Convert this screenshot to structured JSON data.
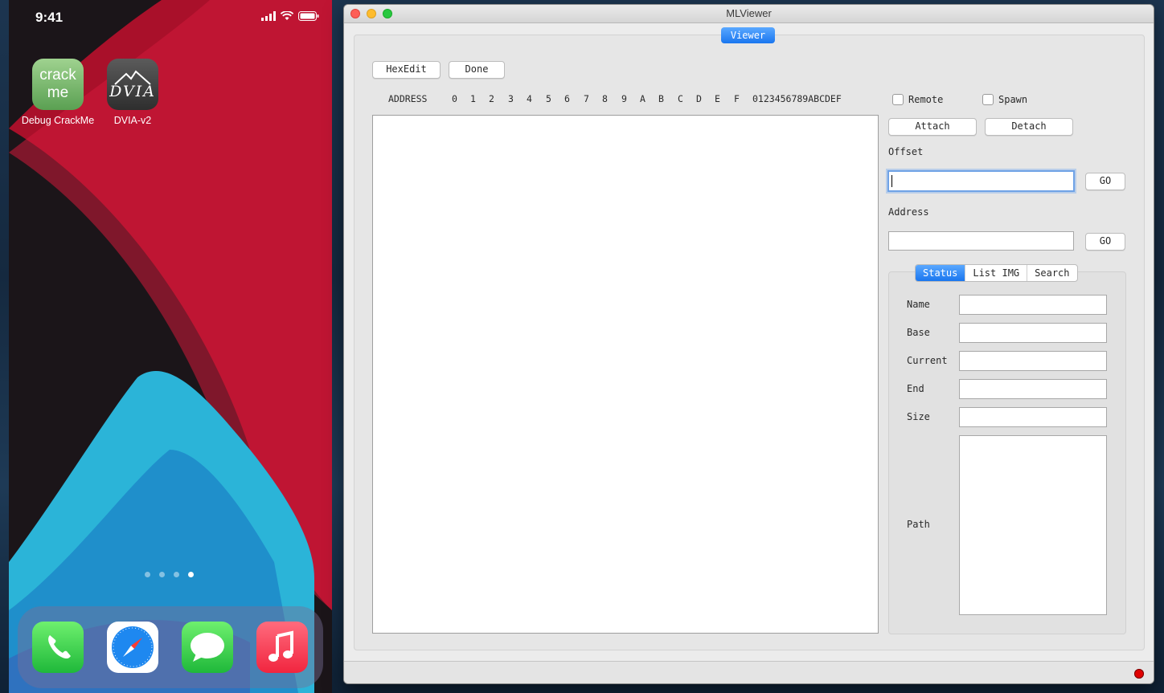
{
  "phone": {
    "time": "9:41",
    "apps": [
      {
        "label": "Debug CrackMe",
        "tile_text_line1": "crack",
        "tile_text_line2": "me"
      },
      {
        "label": "DVIA-v2",
        "tile_text": "DVIA"
      }
    ],
    "dock": [
      "phone-app",
      "safari-app",
      "messages-app",
      "music-app"
    ],
    "page_count": 4,
    "active_page": 4
  },
  "window": {
    "title": "MLViewer",
    "top_tab": "Viewer",
    "hexedit_label": "HexEdit",
    "done_label": "Done",
    "hex_header": {
      "address": "ADDRESS",
      "columns": [
        "0",
        "1",
        "2",
        "3",
        "4",
        "5",
        "6",
        "7",
        "8",
        "9",
        "A",
        "B",
        "C",
        "D",
        "E",
        "F"
      ],
      "ascii": "0123456789ABCDEF"
    },
    "remote_label": "Remote",
    "spawn_label": "Spawn",
    "attach_label": "Attach",
    "detach_label": "Detach",
    "offset_label": "Offset",
    "offset_value": "",
    "offset_go": "GO",
    "address_label": "Address",
    "address_value": "",
    "address_go": "GO",
    "tabs": [
      "Status",
      "List IMG",
      "Search"
    ],
    "selected_tab": "Status",
    "status_fields": {
      "name_label": "Name",
      "base_label": "Base",
      "current_label": "Current",
      "end_label": "End",
      "size_label": "Size",
      "path_label": "Path"
    }
  },
  "colors": {
    "accent": "#1a76ef",
    "record_indicator": "#e00000"
  }
}
